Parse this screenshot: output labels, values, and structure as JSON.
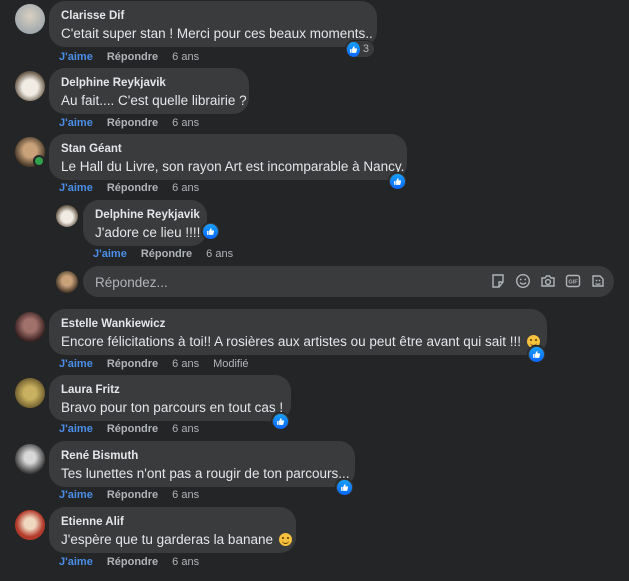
{
  "comments": [
    {
      "name": "Clarisse Dif",
      "text": "C'etait super stan ! Merci pour ces beaux moments..",
      "like": "J'aime",
      "reply": "Répondre",
      "time": "6 ans",
      "reactions": "3"
    },
    {
      "name": "Delphine Reykjavik",
      "text": "Au fait.... C'est quelle librairie ?",
      "like": "J'aime",
      "reply": "Répondre",
      "time": "6 ans"
    },
    {
      "name": "Stan Géant",
      "text": "Le Hall du Livre, son rayon Art est incomparable à Nancy.",
      "like": "J'aime",
      "reply": "Répondre",
      "time": "6 ans"
    },
    {
      "name": "Delphine Reykjavik",
      "text": "J'adore ce lieu !!!!",
      "like": "J'aime",
      "reply": "Répondre",
      "time": "6 ans"
    },
    {
      "name": "Estelle Wankiewicz",
      "text": "Encore félicitations à toi!! A rosières aux artistes ou peut être avant qui sait !!!",
      "like": "J'aime",
      "reply": "Répondre",
      "time": "6 ans",
      "modified": "Modifié"
    },
    {
      "name": "Laura Fritz",
      "text": "Bravo pour ton parcours en tout cas !",
      "like": "J'aime",
      "reply": "Répondre",
      "time": "6 ans"
    },
    {
      "name": "René Bismuth",
      "text": "Tes lunettes n'ont pas a rougir de ton parcours...",
      "like": "J'aime",
      "reply": "Répondre",
      "time": "6 ans"
    },
    {
      "name": "Etienne Alif",
      "text": "J'espère que tu garderas la banane",
      "like": "J'aime",
      "reply": "Répondre",
      "time": "6 ans"
    }
  ],
  "reply_box": {
    "placeholder": "Répondez..."
  },
  "colors": {
    "background": "#242526",
    "bubble": "#3a3b3c",
    "like_blue": "#4a8ee8",
    "like_icon": "#0866ff",
    "online": "#31a24c"
  }
}
